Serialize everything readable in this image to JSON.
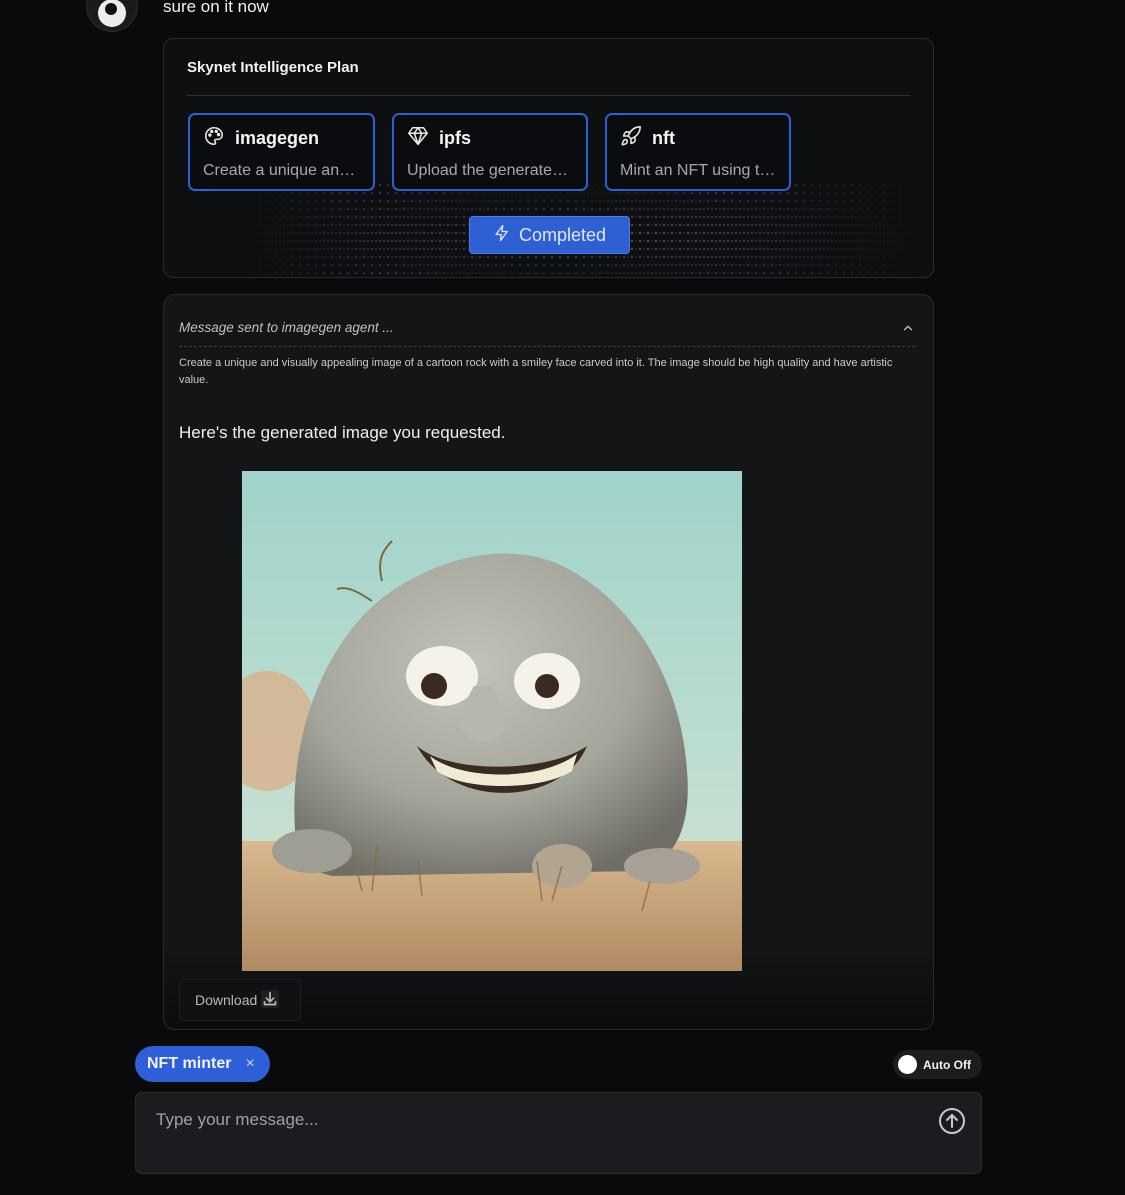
{
  "previous_message": {
    "text": "sure on it now"
  },
  "plan": {
    "title": "Skynet Intelligence Plan",
    "agents": [
      {
        "name": "imagegen",
        "icon": "palette-icon",
        "description": "Create a unique and visually appealing image of a cartoon rock with a smiley face carved into it."
      },
      {
        "name": "ipfs",
        "icon": "gem-icon",
        "description": "Upload the generated image to IPFS"
      },
      {
        "name": "nft",
        "icon": "rocket-icon",
        "description": "Mint an NFT using the uploaded image"
      }
    ],
    "status_label": "Completed",
    "accent_color": "#2d5fd6"
  },
  "message": {
    "header": "Message sent to imagegen agent ...",
    "body": "Create a unique and visually appealing image of a cartoon rock with a smiley face carved into it. The image should be high quality and have artistic value.",
    "response": "Here's the generated image you requested.",
    "image_alt": "cartoon rock with a smiley face",
    "download_label": "Download"
  },
  "composer": {
    "chip_label": "NFT minter",
    "chip_close": "×",
    "auto_label": "Auto Off",
    "placeholder": "Type your message..."
  }
}
